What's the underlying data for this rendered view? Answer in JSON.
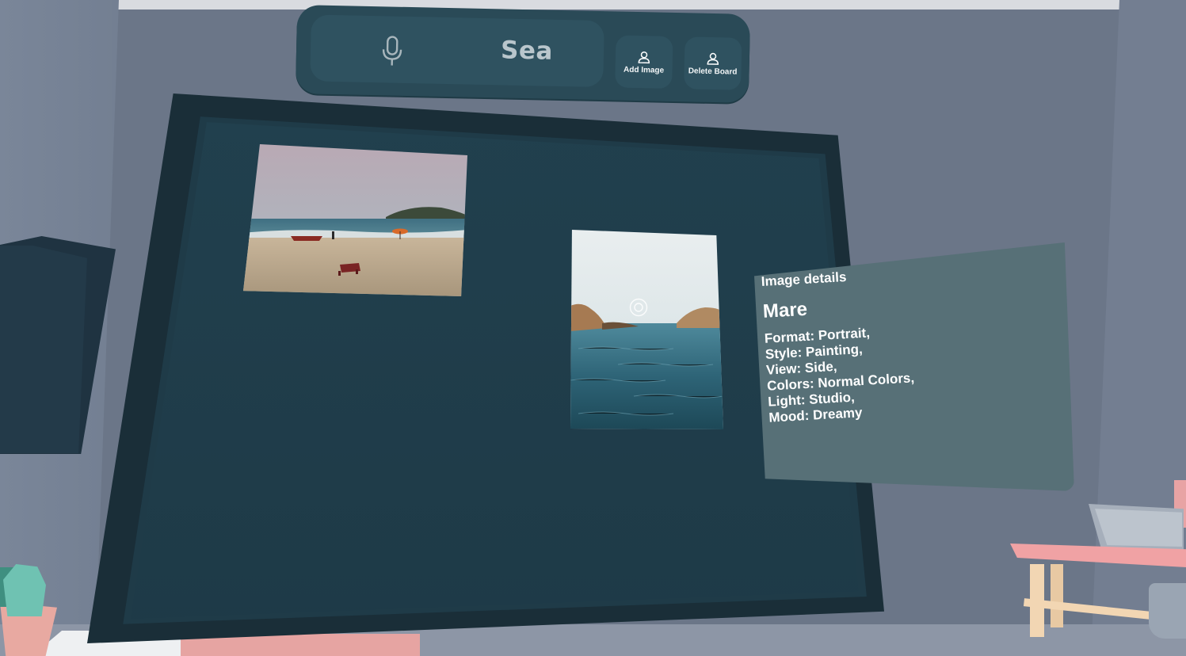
{
  "toolbar": {
    "search_text": "Sea",
    "mic_icon": "microphone-icon",
    "add_image_label": "Add Image",
    "delete_board_label": "Delete Board",
    "button_icon": "person-icon"
  },
  "board": {
    "images": [
      {
        "subject": "beach"
      },
      {
        "subject": "sea"
      }
    ]
  },
  "details": {
    "heading": "Image details",
    "name": "Mare",
    "lines": [
      "Format: Portrait,",
      "Style: Painting,",
      "View: Side,",
      "Colors: Normal Colors,",
      "Light: Studio,",
      "Mood: Dreamy"
    ]
  },
  "colors": {
    "toolbar": "#2a4a57",
    "board": "#1f3b48",
    "panel": "#577077",
    "wall": "#6b7688"
  }
}
